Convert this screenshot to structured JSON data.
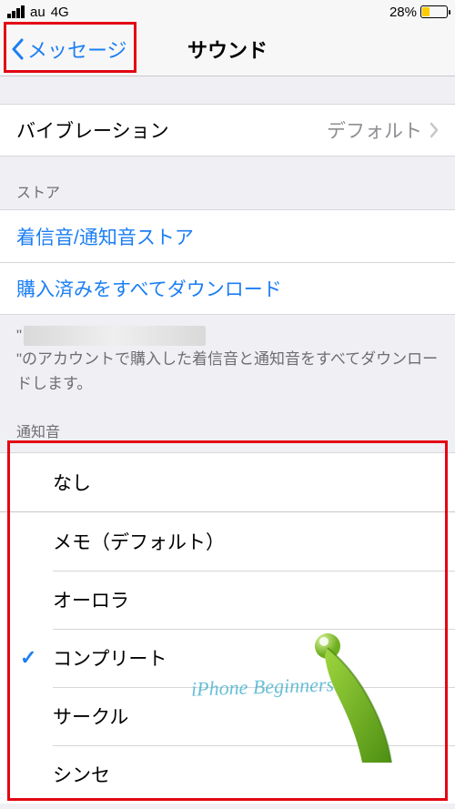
{
  "status": {
    "carrier": "au",
    "network": "4G",
    "battery_pct": "28%",
    "battery_fill_width": "28%"
  },
  "nav": {
    "back_label": "メッセージ",
    "title": "サウンド"
  },
  "vibration": {
    "label": "バイブレーション",
    "value": "デフォルト"
  },
  "store": {
    "header": "ストア",
    "tone_store": "着信音/通知音ストア",
    "download_all": "購入済みをすべてダウンロード",
    "footer_prefix": "\"",
    "footer_suffix": "\"のアカウントで購入した着信音と通知音をすべてダウンロードします。"
  },
  "sounds": {
    "header": "通知音",
    "items": [
      {
        "label": "なし",
        "selected": false,
        "group_break_after": true
      },
      {
        "label": "メモ（デフォルト）",
        "selected": false
      },
      {
        "label": "オーロラ",
        "selected": false
      },
      {
        "label": "コンプリート",
        "selected": true
      },
      {
        "label": "サークル",
        "selected": false
      },
      {
        "label": "シンセ",
        "selected": false
      }
    ]
  },
  "watermark": "iPhone Beginners"
}
